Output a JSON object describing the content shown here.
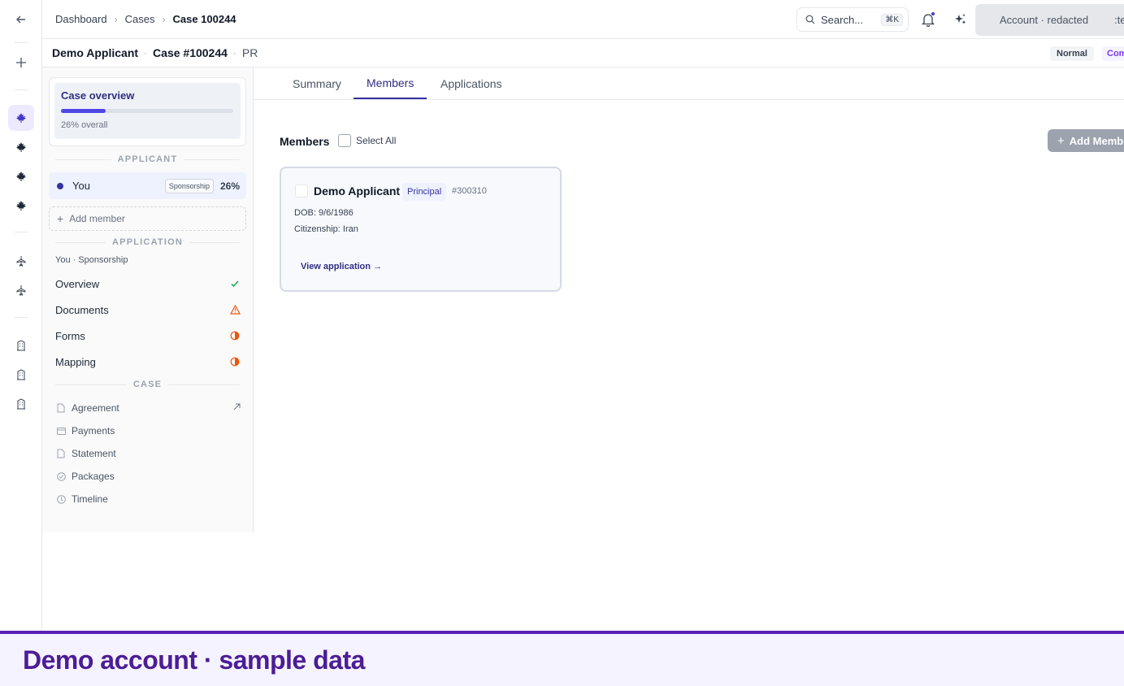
{
  "rail": {
    "icons": [
      "arrow-left-icon",
      "plus-icon",
      "maple-leaf-icon",
      "maple-leaf-icon",
      "maple-leaf-icon",
      "maple-leaf-icon",
      "airplane-icon",
      "airplane-icon",
      "building-icon",
      "building-icon",
      "building-icon"
    ]
  },
  "topbar": {
    "breadcrumbs": [
      "Dashboard",
      "Cases",
      "Case 100244"
    ],
    "search_placeholder": "Search...",
    "search_shortcut": "⌘K",
    "account_label": "Account · redacted",
    "account_extra": ":te"
  },
  "case_header": {
    "applicant_name": "Demo Applicant",
    "case_number": "Case #100244",
    "program": "PR",
    "priority": "Normal",
    "status": "Com"
  },
  "sidebar": {
    "overview": {
      "title": "Case overview",
      "progress_percent": 26,
      "progress_label": "26% overall"
    },
    "applicant_section": "APPLICANT",
    "member": {
      "name": "You",
      "tag": "Sponsorship",
      "percent": "26%"
    },
    "add_member_label": "Add member",
    "application_section": "APPLICATION",
    "application_subtitle": "You · Sponsorship",
    "application_items": [
      {
        "label": "Overview",
        "status": "complete"
      },
      {
        "label": "Documents",
        "status": "warning"
      },
      {
        "label": "Forms",
        "status": "partial"
      },
      {
        "label": "Mapping",
        "status": "partial"
      }
    ],
    "case_section": "CASE",
    "case_items": [
      {
        "label": "Agreement",
        "icon": "document-icon"
      },
      {
        "label": "Payments",
        "icon": "card-icon"
      },
      {
        "label": "Statement",
        "icon": "document-icon"
      },
      {
        "label": "Packages",
        "icon": "check-circle-icon"
      },
      {
        "label": "Timeline",
        "icon": "clock-icon"
      }
    ]
  },
  "tabs": [
    "Summary",
    "Members",
    "Applications"
  ],
  "active_tab": "Members",
  "members": {
    "title": "Members",
    "select_all_label": "Select All",
    "add_button_label": "Add Memb",
    "cards": [
      {
        "name": "Demo Applicant",
        "role": "Principal",
        "id": "#300310",
        "dob": "DOB: 9/6/1986",
        "citizenship": "Citizenship: Iran",
        "link": "View application →"
      }
    ]
  },
  "banner": {
    "text": "Demo account · sample data"
  },
  "colors": {
    "accent": "#3730a3",
    "banner_border": "#5b21b6",
    "banner_text": "#4c1d95",
    "warning": "#ea580c",
    "success": "#16a34a"
  }
}
